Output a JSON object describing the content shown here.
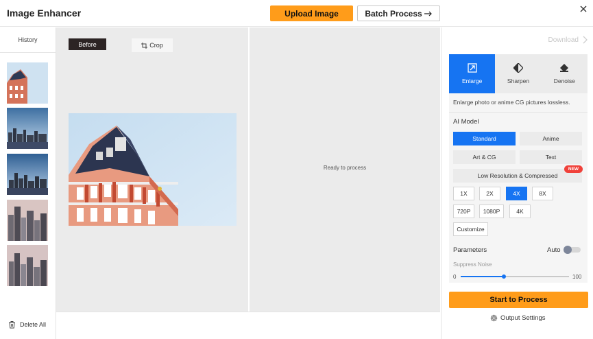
{
  "app": {
    "title": "Image Enhancer"
  },
  "header": {
    "upload_label": "Upload Image",
    "batch_label": "Batch Process"
  },
  "sidebar": {
    "history_label": "History",
    "thumbnails": [
      "building-thumbnail",
      "city-skyline-thumbnail",
      "city-skyline-thumbnail",
      "city-towers-thumbnail",
      "city-towers-thumbnail"
    ],
    "delete_all_label": "Delete All"
  },
  "workspace": {
    "before_label": "Before",
    "crop_label": "Crop",
    "ready_text": "Ready to process"
  },
  "panel": {
    "download_label": "Download",
    "tabs": [
      {
        "label": "Enlarge",
        "icon": "enlarge-icon",
        "active": true
      },
      {
        "label": "Sharpen",
        "icon": "sharpen-icon",
        "active": false
      },
      {
        "label": "Denoise",
        "icon": "denoise-icon",
        "active": false
      }
    ],
    "description": "Enlarge photo or anime CG pictures lossless.",
    "ai_model_label": "AI Model",
    "models": {
      "standard": "Standard",
      "anime": "Anime",
      "art_cg": "Art & CG",
      "text": "Text",
      "low_res": "Low Resolution & Compressed",
      "selected": "Standard"
    },
    "new_badge": "NEW",
    "scales": {
      "x1": "1X",
      "x2": "2X",
      "x4": "4X",
      "x8": "8X",
      "selected": "4X"
    },
    "resolutions": {
      "p720": "720P",
      "p1080": "1080P",
      "k4": "4K"
    },
    "customize_label": "Customize",
    "parameters_label": "Parameters",
    "auto_label": "Auto",
    "auto_enabled": false,
    "suppress_noise_label": "Suppress Noise",
    "slider": {
      "min": "0",
      "max": "100",
      "value": 40
    },
    "start_label": "Start to Process",
    "output_settings_label": "Output Settings"
  },
  "colors": {
    "accent_blue": "#1674f2",
    "accent_orange": "#ff9c1a",
    "new_red": "#f0413a"
  }
}
